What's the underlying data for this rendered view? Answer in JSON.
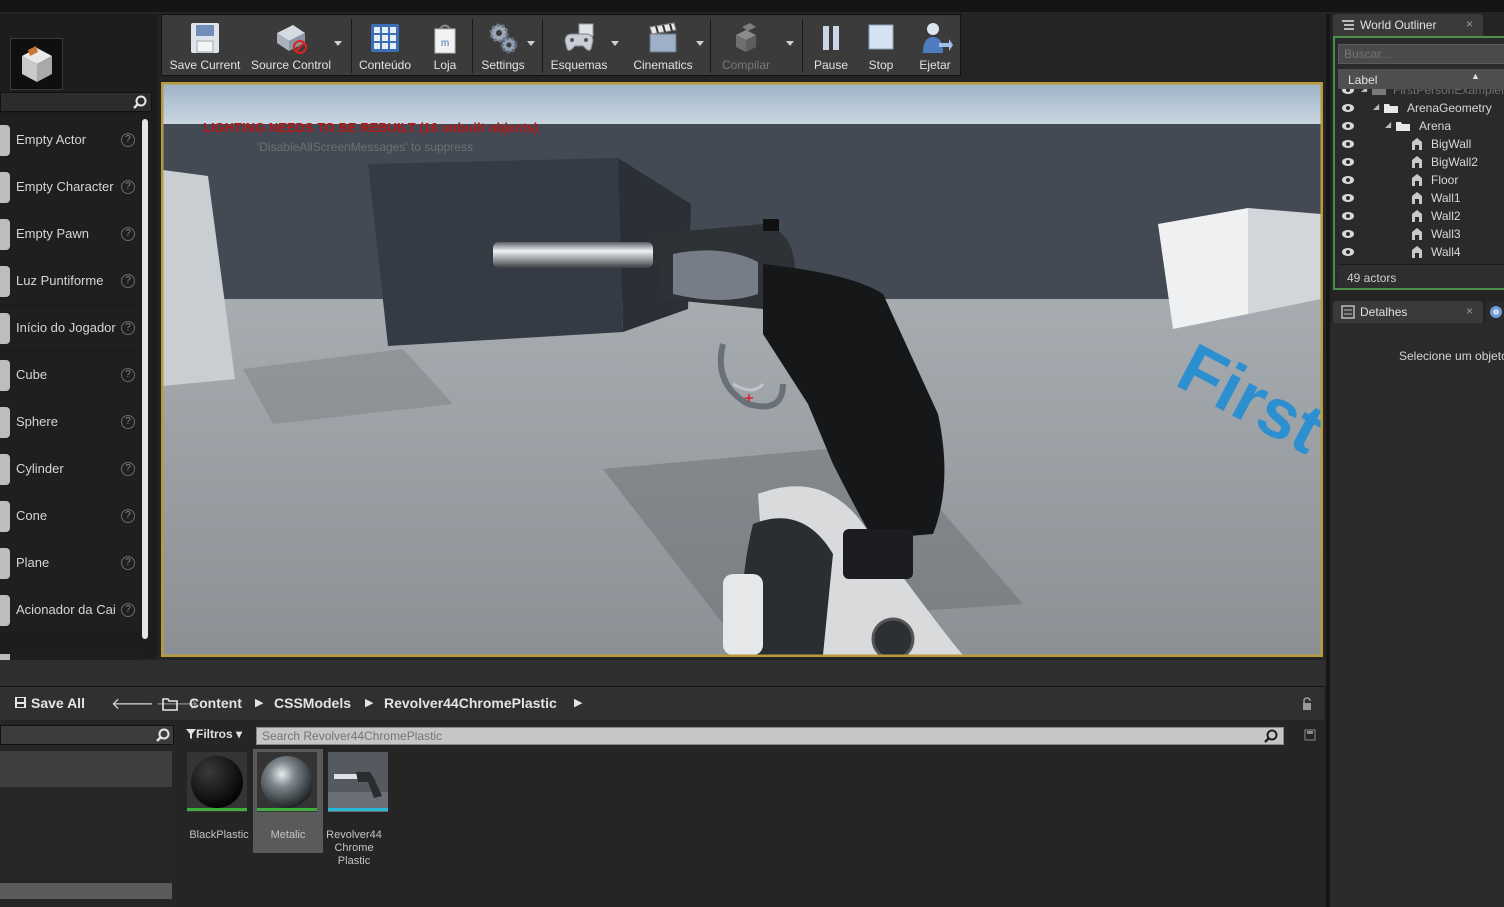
{
  "toolbar": {
    "buttons": [
      {
        "label": "Save Current",
        "icon": "floppy-disk-icon"
      },
      {
        "label": "Source Control",
        "icon": "source-control-icon"
      },
      {
        "label": "Conteúdo",
        "icon": "content-grid-icon"
      },
      {
        "label": "Loja",
        "icon": "shopping-bag-icon"
      },
      {
        "label": "Settings",
        "icon": "gear-icon"
      },
      {
        "label": "Esquemas",
        "icon": "gamepad-icon"
      },
      {
        "label": "Cinematics",
        "icon": "clapperboard-icon"
      },
      {
        "label": "Compilar",
        "icon": "compile-blocks-icon"
      },
      {
        "label": "Pause",
        "icon": "pause-icon"
      },
      {
        "label": "Stop",
        "icon": "stop-icon"
      },
      {
        "label": "Ejetar",
        "icon": "eject-person-icon"
      }
    ]
  },
  "place_panel": {
    "items": [
      {
        "label": "Empty Actor"
      },
      {
        "label": "Empty Character"
      },
      {
        "label": "Empty Pawn"
      },
      {
        "label": "Luz Puntiforme"
      },
      {
        "label": "Início do Jogador"
      },
      {
        "label": "Cube"
      },
      {
        "label": "Sphere"
      },
      {
        "label": "Cylinder"
      },
      {
        "label": "Cone"
      },
      {
        "label": "Plane"
      },
      {
        "label": "Acionador da Cai"
      }
    ],
    "help_glyph": "?"
  },
  "viewport": {
    "warning": "LIGHTING NEEDS TO BE REBUILT (16 unbuilt objects)",
    "sub_warning": "'DisableAllScreenMessages' to suppress",
    "floor_text": "First Per"
  },
  "outliner": {
    "title": "World Outliner",
    "close": "×",
    "search_placeholder": "Buscar...",
    "header_label": "Label",
    "rows": [
      {
        "name": "FirstPersonExampleMap",
        "level": 0,
        "type": "world"
      },
      {
        "name": "ArenaGeometry",
        "level": 1,
        "type": "folder"
      },
      {
        "name": "Arena",
        "level": 2,
        "type": "folder"
      },
      {
        "name": "BigWall",
        "level": 3,
        "type": "actor"
      },
      {
        "name": "BigWall2",
        "level": 3,
        "type": "actor"
      },
      {
        "name": "Floor",
        "level": 3,
        "type": "actor"
      },
      {
        "name": "Wall1",
        "level": 3,
        "type": "actor"
      },
      {
        "name": "Wall2",
        "level": 3,
        "type": "actor"
      },
      {
        "name": "Wall3",
        "level": 3,
        "type": "actor"
      },
      {
        "name": "Wall4",
        "level": 3,
        "type": "actor"
      }
    ],
    "count": "49 actors"
  },
  "details": {
    "title": "Detalhes",
    "close": "×",
    "message": "Selecione um objeto"
  },
  "content_browser": {
    "save_all": "Save All",
    "breadcrumb": [
      "Content",
      "CSSModels",
      "Revolver44ChromePlastic"
    ],
    "filters": "Filtros",
    "search_placeholder": "Search Revolver44ChromePlastic",
    "assets": [
      {
        "label": "BlackPlastic",
        "type": "material",
        "bar_color": "#3fae3f"
      },
      {
        "label": "Metalic",
        "type": "material",
        "bar_color": "#3fae3f"
      },
      {
        "label": "Revolver44 Chrome Plastic",
        "type": "static-mesh",
        "bar_color": "#27b9d6"
      }
    ]
  }
}
